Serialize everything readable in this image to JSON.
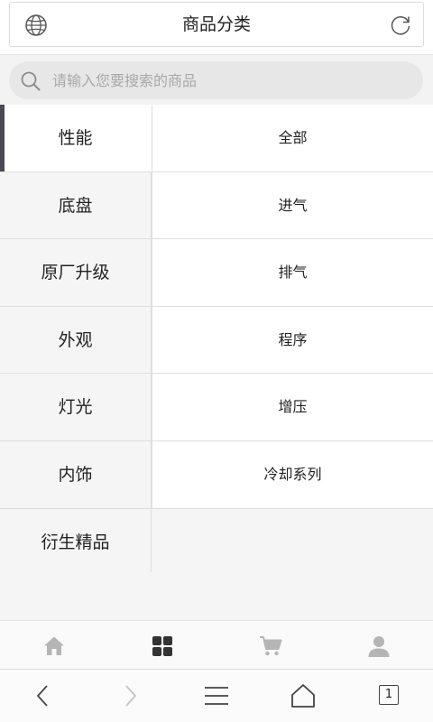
{
  "header": {
    "title": "商品分类",
    "left_icon": "globe-icon",
    "right_icon": "refresh-icon"
  },
  "search": {
    "placeholder": "请输入您要搜索的商品",
    "icon": "search-icon"
  },
  "categories": [
    {
      "label": "性能",
      "active": true
    },
    {
      "label": "底盘"
    },
    {
      "label": "原厂升级"
    },
    {
      "label": "外观"
    },
    {
      "label": "灯光"
    },
    {
      "label": "内饰"
    },
    {
      "label": "衍生精品"
    }
  ],
  "subcategories": [
    {
      "label": "全部"
    },
    {
      "label": "进气"
    },
    {
      "label": "排气"
    },
    {
      "label": "程序"
    },
    {
      "label": "增压"
    },
    {
      "label": "冷却系列"
    }
  ],
  "tabbar": {
    "items": [
      {
        "icon": "home-icon",
        "active": false
      },
      {
        "icon": "category-grid-icon",
        "active": true
      },
      {
        "icon": "cart-icon",
        "active": false
      },
      {
        "icon": "user-icon",
        "active": false
      }
    ],
    "active_color": "#333333",
    "inactive_color": "#b5b5b5"
  },
  "browser_bar": {
    "tab_count": "1",
    "icons": [
      "back-icon",
      "forward-icon",
      "menu-icon",
      "home-outline-icon",
      "tabs-icon"
    ]
  }
}
